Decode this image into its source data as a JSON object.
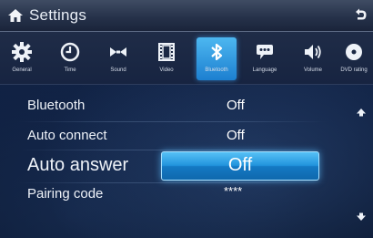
{
  "header": {
    "title": "Settings",
    "home_icon": "home-icon",
    "back_icon": "back-icon"
  },
  "tabs": [
    {
      "label": "General",
      "icon": "gear-icon"
    },
    {
      "label": "Time",
      "icon": "clock-icon"
    },
    {
      "label": "Sound",
      "icon": "bowtie-sound-icon"
    },
    {
      "label": "Video",
      "icon": "film-icon"
    },
    {
      "label": "Bluetooth",
      "icon": "bluetooth-icon",
      "active": true
    },
    {
      "label": "Language",
      "icon": "speech-bubble-icon"
    },
    {
      "label": "Volume",
      "icon": "speaker-icon"
    },
    {
      "label": "DVD rating",
      "icon": "disc-icon"
    }
  ],
  "settings": [
    {
      "label": "Bluetooth",
      "value": "Off"
    },
    {
      "label": "Auto connect",
      "value": "Off"
    },
    {
      "label": "Auto answer",
      "value": "Off",
      "selected": true
    },
    {
      "label": "Pairing code",
      "value": "****"
    }
  ],
  "scroll": {
    "up_icon": "arrow-up-icon",
    "down_icon": "arrow-down-icon"
  },
  "colors": {
    "accent": "#2a96e0",
    "background": "#0e1e3e",
    "titlebar": "#2e3a52"
  }
}
